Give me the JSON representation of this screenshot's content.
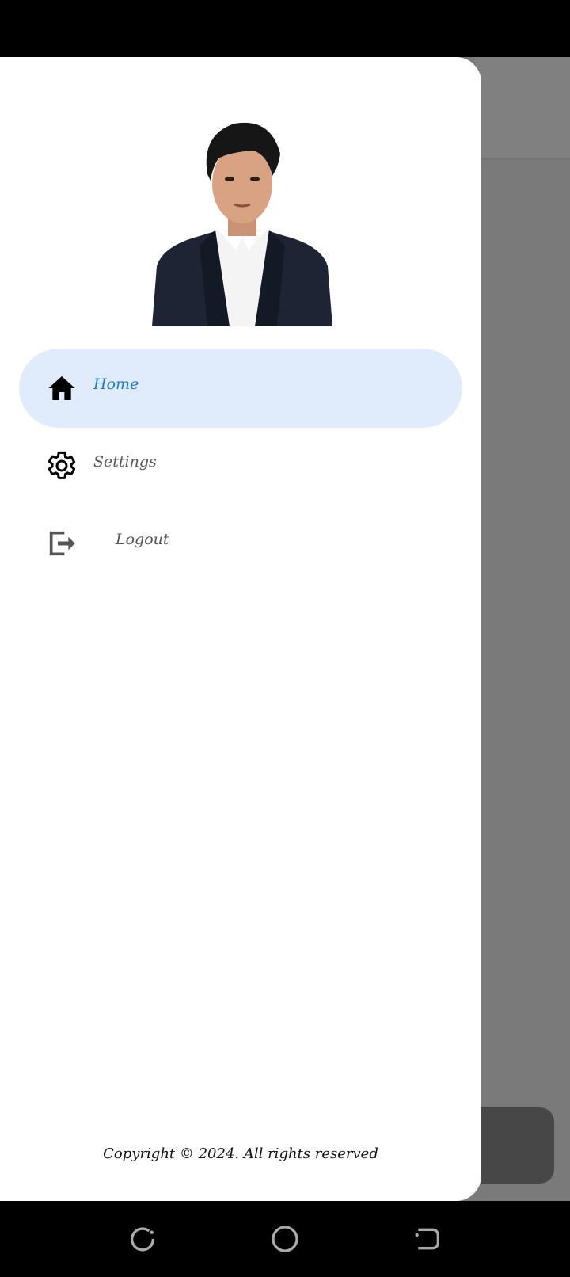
{
  "drawer": {
    "items": [
      {
        "label": "Home",
        "icon": "home-icon",
        "active": true
      },
      {
        "label": "Settings",
        "icon": "gear-icon",
        "active": false
      },
      {
        "label": "Logout",
        "icon": "logout-icon",
        "active": false
      }
    ],
    "footer": "Copyright © 2024. All rights reserved"
  },
  "colors": {
    "active_bg": "#e0ecfb",
    "active_text": "#1f77c4",
    "scrim": "#7a7a7a"
  },
  "system_nav": {
    "buttons": [
      "recent-apps-icon",
      "home-circle-icon",
      "back-icon"
    ]
  }
}
